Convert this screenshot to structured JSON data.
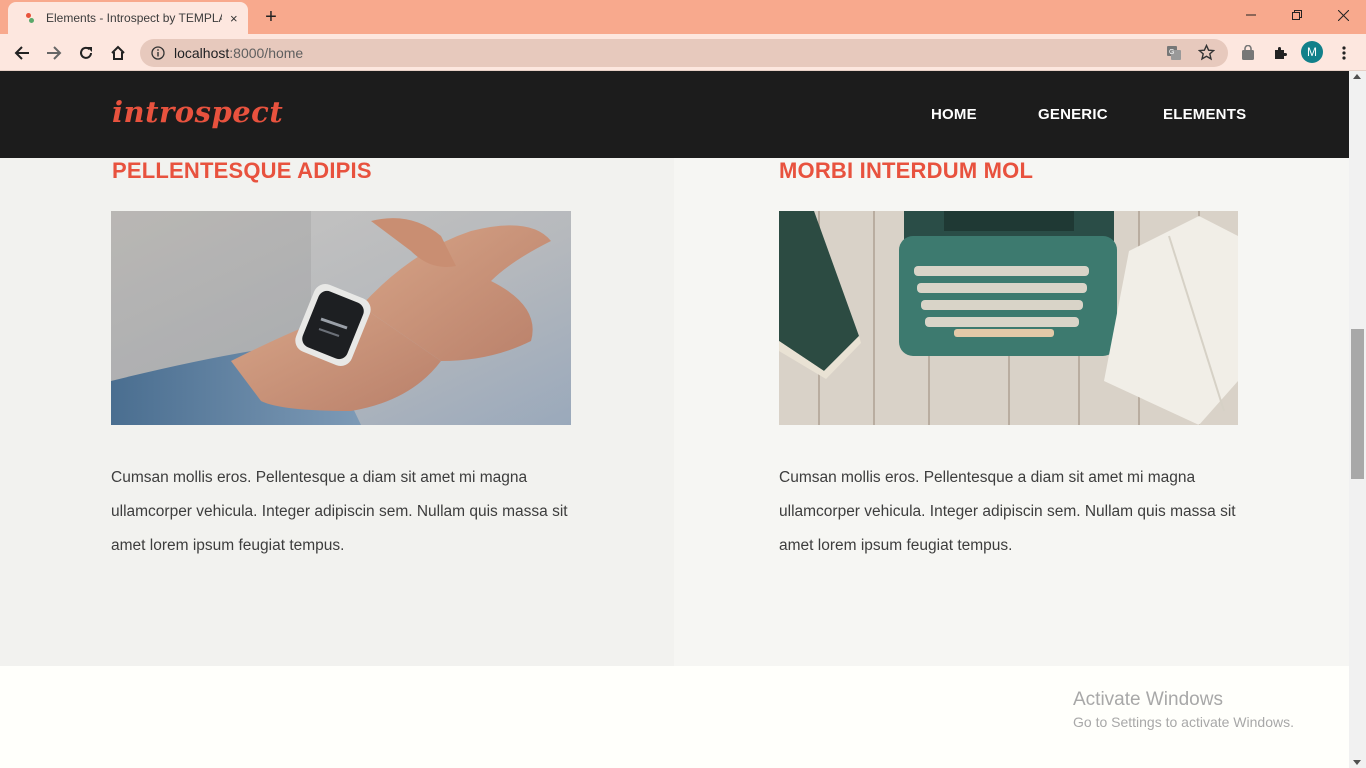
{
  "browser": {
    "tab_title": "Elements - Introspect by TEMPLA",
    "tab_close": "×",
    "new_tab": "+",
    "url_host": "localhost",
    "url_rest": ":8000/home",
    "avatar_initial": "M"
  },
  "site": {
    "logo": "introspect",
    "nav": [
      "HOME",
      "GENERIC",
      "ELEMENTS"
    ]
  },
  "sections": [
    {
      "title": "PELLENTESQUE ADIPIS",
      "image": "smartwatch-on-wrist",
      "text": "Cumsan mollis eros. Pellentesque a diam sit amet mi magna ullamcorper vehicula. Integer adipiscin sem. Nullam quis massa sit amet lorem ipsum feugiat tempus."
    },
    {
      "title": "MORBI INTERDUM MOL",
      "image": "typewriter-on-desk",
      "text": "Cumsan mollis eros. Pellentesque a diam sit amet mi magna ullamcorper vehicula. Integer adipiscin sem. Nullam quis massa sit amet lorem ipsum feugiat tempus."
    }
  ],
  "watermark": {
    "title": "Activate Windows",
    "subtitle": "Go to Settings to activate Windows."
  },
  "colors": {
    "accent": "#e8523e",
    "header_bg": "#1c1c1c",
    "tabbar_bg": "#f8a98d"
  }
}
